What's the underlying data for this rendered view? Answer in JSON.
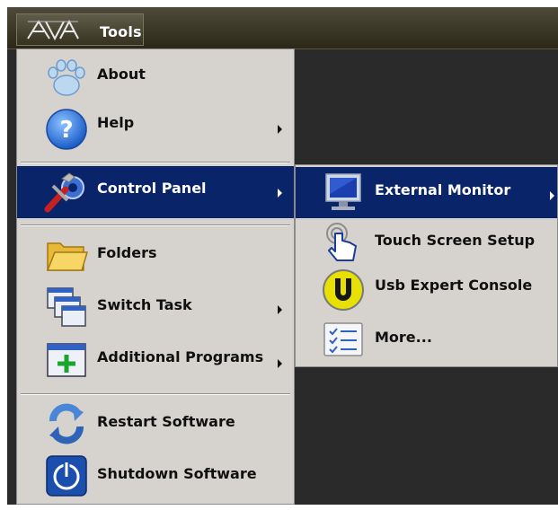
{
  "topbar": {
    "tools_label": "Tools",
    "logo_icon": "avolites-logo-icon"
  },
  "main_menu": {
    "items": [
      {
        "label": "About",
        "icon": "paw-icon",
        "submenu": false
      },
      {
        "label": "Help",
        "icon": "help-icon",
        "submenu": true
      },
      {
        "label": "Control Panel",
        "icon": "wrench-gear-icon",
        "submenu": true,
        "selected": true
      },
      {
        "label": "Folders",
        "icon": "folder-icon",
        "submenu": false
      },
      {
        "label": "Switch Task",
        "icon": "windows-stack-icon",
        "submenu": true
      },
      {
        "label": "Additional Programs",
        "icon": "add-window-icon",
        "submenu": true
      },
      {
        "label": "Restart Software",
        "icon": "restart-icon",
        "submenu": false
      },
      {
        "label": "Shutdown Software",
        "icon": "power-icon",
        "submenu": false
      }
    ]
  },
  "sub_menu": {
    "items": [
      {
        "label": "External Monitor",
        "icon": "monitor-icon",
        "submenu": true,
        "selected": true
      },
      {
        "label": "Touch Screen Setup",
        "icon": "touch-hand-icon",
        "submenu": false
      },
      {
        "label": "Usb Expert Console",
        "icon": "usb-u-icon",
        "submenu": false
      },
      {
        "label": "More...",
        "icon": "checklist-icon",
        "submenu": false
      }
    ]
  },
  "colors": {
    "menu_bg": "#d6d3ce",
    "selection": "#0a246a",
    "desktop": "#2a2a2a"
  }
}
